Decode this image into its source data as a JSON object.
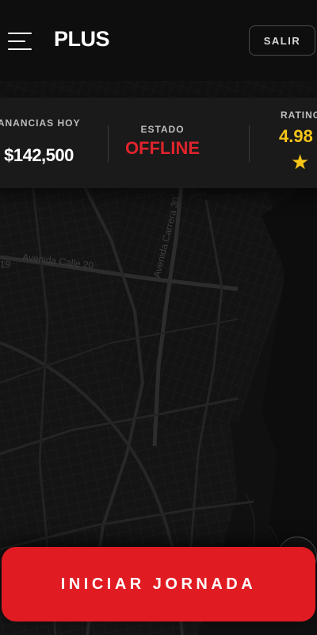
{
  "header": {
    "logo": "PLUS",
    "exit_label": "SALIR",
    "menu_icon": "hamburger-icon"
  },
  "stats": {
    "earnings_label": "GANANCIAS HOY",
    "earnings_value": "$142,500",
    "status_label": "ESTADO",
    "status_value": "OFFLINE",
    "rating_label": "RATING",
    "rating_value": "4.98",
    "rating_icon": "star-icon"
  },
  "map": {
    "street_labels": [
      "Avenida Calle 20",
      "Avenida Carrera 30",
      "19"
    ]
  },
  "actions": {
    "start_label": "INICIAR JORNADA"
  },
  "colors": {
    "accent_red": "#e11b22",
    "status_offline": "#e0242c",
    "rating_gold": "#f5c518",
    "background": "#0b0b0b",
    "card": "#1a1a1a"
  }
}
